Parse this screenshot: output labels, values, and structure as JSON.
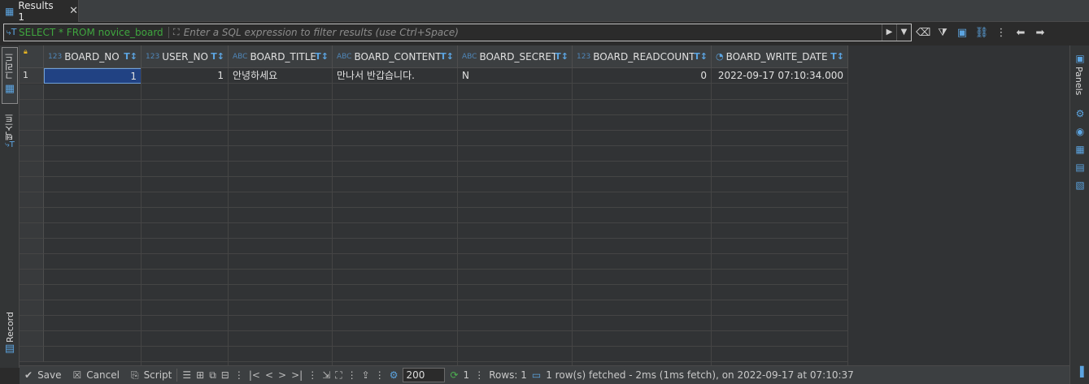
{
  "tab": {
    "title": "Results 1",
    "icon": "grid-icon",
    "close": "✕"
  },
  "filter": {
    "sql": "SELECT * FROM novice_board",
    "placeholder": "Enter a SQL expression to filter results (use Ctrl+Space)"
  },
  "left_tabs": {
    "grid": "그리드",
    "text": "텍스트",
    "record": "Record"
  },
  "right_panel": {
    "label": "Panels"
  },
  "columns": [
    {
      "type": "123",
      "name": "BOARD_NO"
    },
    {
      "type": "123",
      "name": "USER_NO"
    },
    {
      "type": "ABC",
      "name": "BOARD_TITLE"
    },
    {
      "type": "ABC",
      "name": "BOARD_CONTENT"
    },
    {
      "type": "ABC",
      "name": "BOARD_SECRET"
    },
    {
      "type": "123",
      "name": "BOARD_READCOUNT"
    },
    {
      "type": "clock",
      "name": "BOARD_WRITE_DATE"
    }
  ],
  "rows": [
    {
      "num": "1",
      "cells": [
        "1",
        "1",
        "안녕하세요",
        "만나서 반갑습니다.",
        "N",
        "0",
        "2022-09-17 07:10:34.000"
      ]
    }
  ],
  "bottom": {
    "save": "Save",
    "cancel": "Cancel",
    "script": "Script",
    "fetch_size": "200",
    "refresh_count": "1",
    "rows": "Rows: 1",
    "status": "1 row(s) fetched - 2ms (1ms fetch), on 2022-09-17 at 07:10:37"
  },
  "colors": {
    "accent": "#5ca4e0",
    "selected": "#214283",
    "sql": "#3fa63f"
  }
}
